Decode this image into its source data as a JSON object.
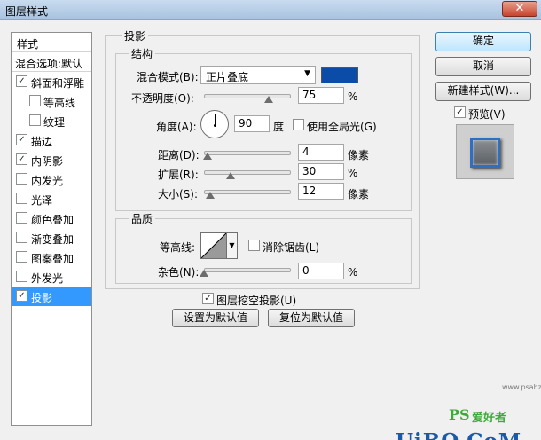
{
  "window": {
    "title": "图层样式",
    "close_glyph": "✕"
  },
  "sidebar": {
    "items": [
      {
        "label": "样式"
      },
      {
        "label": "混合选项:默认"
      },
      {
        "label": "斜面和浮雕",
        "checked": true
      },
      {
        "label": "等高线",
        "checked": false
      },
      {
        "label": "纹理",
        "checked": false
      },
      {
        "label": "描边",
        "checked": true
      },
      {
        "label": "内阴影",
        "checked": true
      },
      {
        "label": "内发光",
        "checked": false
      },
      {
        "label": "光泽",
        "checked": false
      },
      {
        "label": "颜色叠加",
        "checked": false
      },
      {
        "label": "渐变叠加",
        "checked": false
      },
      {
        "label": "图案叠加",
        "checked": false
      },
      {
        "label": "外发光",
        "checked": false
      },
      {
        "label": "投影",
        "checked": true,
        "selected": true
      }
    ],
    "check_glyph": "✓"
  },
  "panel": {
    "title": "投影",
    "structure": {
      "title": "结构",
      "blend_mode_label": "混合模式(B):",
      "blend_mode_value": "正片叠底",
      "blend_color": "#0a4ca8",
      "opacity_label": "不透明度(O):",
      "opacity_value": "75",
      "opacity_unit": "%",
      "angle_label": "角度(A):",
      "angle_value": "90",
      "angle_unit": "度",
      "global_light_label": "使用全局光(G)",
      "global_light_checked": false,
      "distance_label": "距离(D):",
      "distance_value": "4",
      "distance_unit": "像素",
      "spread_label": "扩展(R):",
      "spread_value": "30",
      "spread_unit": "%",
      "size_label": "大小(S):",
      "size_value": "12",
      "size_unit": "像素"
    },
    "quality": {
      "title": "品质",
      "contour_label": "等高线:",
      "anti_alias_label": "消除锯齿(L)",
      "anti_alias_checked": false,
      "noise_label": "杂色(N):",
      "noise_value": "0",
      "noise_unit": "%"
    },
    "knockout_label": "图层挖空投影(U)",
    "knockout_checked": true,
    "make_default_label": "设置为默认值",
    "reset_default_label": "复位为默认值"
  },
  "buttons": {
    "ok": "确定",
    "cancel": "取消",
    "new_style": "新建样式(W)...",
    "preview_label": "预览(V)",
    "preview_checked": true
  },
  "watermark": {
    "ps": "PS",
    "site": "爱好者",
    "logo": "UiBQ.CoM",
    "small": "www.psahz.com"
  },
  "colors": {
    "accent": "#3399ff",
    "shadow_color": "#0a4ca8"
  }
}
